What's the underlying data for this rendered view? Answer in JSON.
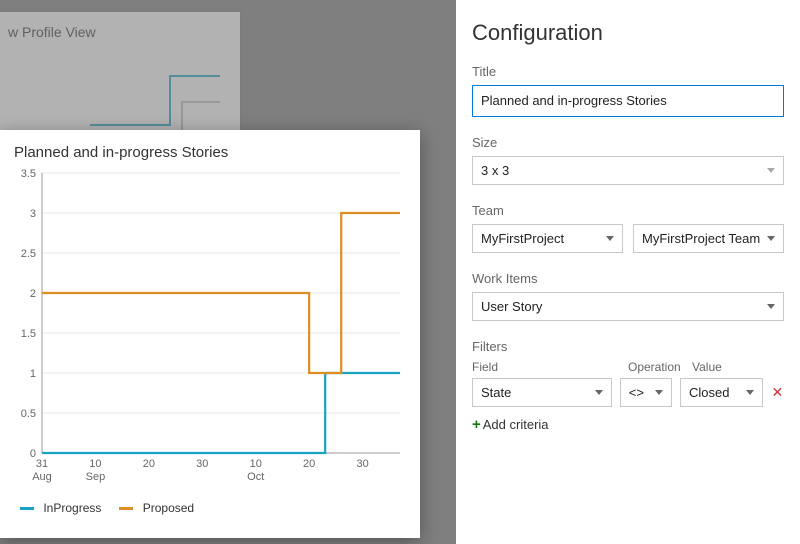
{
  "background_tile": {
    "title": "w Profile View"
  },
  "preview": {
    "title": "Planned and in-progress Stories"
  },
  "legend": {
    "inprogress": {
      "label": "InProgress",
      "color": "#1aa2c4"
    },
    "proposed": {
      "label": "Proposed",
      "color": "#de8e23"
    }
  },
  "config": {
    "heading": "Configuration",
    "title_label": "Title",
    "title_value": "Planned and in-progress Stories",
    "size_label": "Size",
    "size_value": "3 x 3",
    "team_label": "Team",
    "team_project": "MyFirstProject",
    "team_name": "MyFirstProject Team",
    "workitems_label": "Work Items",
    "workitems_value": "User Story",
    "filters_label": "Filters",
    "filters_columns": {
      "field": "Field",
      "operation": "Operation",
      "value": "Value"
    },
    "filter_row": {
      "field": "State",
      "operation": "<>",
      "value": "Closed"
    },
    "add_criteria": "Add criteria"
  },
  "chart_data": {
    "type": "line",
    "title": "Planned and in-progress Stories",
    "xlabel": "",
    "ylabel": "",
    "ylim": [
      0,
      3.5
    ],
    "y_ticks": [
      0,
      0.5,
      1,
      1.5,
      2,
      2.5,
      3,
      3.5
    ],
    "x_tick_labels": [
      "31 Aug",
      "10 Sep",
      "20",
      "30",
      "10 Oct",
      "20",
      "30"
    ],
    "x_index_range": [
      0,
      67
    ],
    "series": [
      {
        "name": "InProgress",
        "color": "#1aa2c4",
        "points": [
          {
            "xi": 0,
            "y": 0
          },
          {
            "xi": 53,
            "y": 0
          },
          {
            "xi": 53,
            "y": 1
          },
          {
            "xi": 67,
            "y": 1
          }
        ]
      },
      {
        "name": "Proposed",
        "color": "#de8e23",
        "points": [
          {
            "xi": 0,
            "y": 2
          },
          {
            "xi": 50,
            "y": 2
          },
          {
            "xi": 50,
            "y": 1
          },
          {
            "xi": 56,
            "y": 1
          },
          {
            "xi": 56,
            "y": 3
          },
          {
            "xi": 67,
            "y": 3
          }
        ]
      }
    ]
  }
}
